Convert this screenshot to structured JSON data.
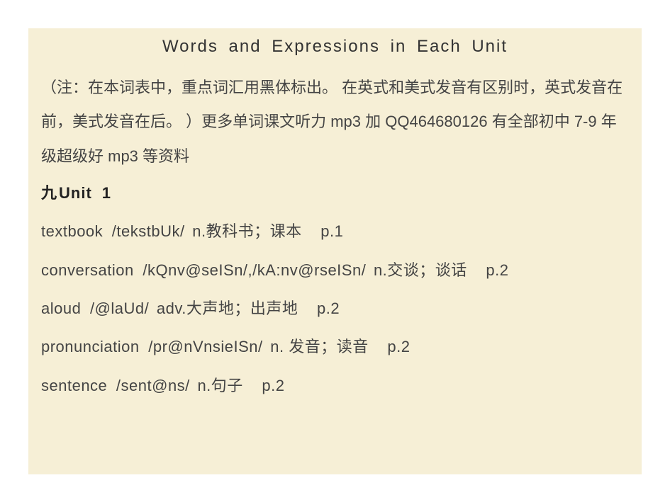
{
  "title": "Words  and  Expressions  in  Each  Unit",
  "note": "（注：在本词表中，重点词汇用黑体标出。  在英式和美式发音有区别时，英式发音在前，美式发音在后。 ）更多单词课文听力  mp3 加 QQ464680126 有全部初中 7-9 年级超级好 mp3 等资料",
  "unit": {
    "prefix": "九",
    "label": "Unit",
    "number": "1"
  },
  "entries": [
    {
      "word": "textbook",
      "phonetic": "/tekstbUk/",
      "definition": "n.教科书；课本",
      "page": "p.1"
    },
    {
      "word": "conversation",
      "phonetic": "/kQnv@seISn/,/kA:nv@rseISn/",
      "definition": "n.交谈；谈话",
      "page": "p.2"
    },
    {
      "word": "aloud",
      "phonetic": "/@laUd/",
      "definition": "adv.大声地；出声地",
      "page": "p.2"
    },
    {
      "word": "pronunciation",
      "phonetic": "/pr@nVnsieISn/",
      "definition": "n. 发音；读音",
      "page": "p.2"
    },
    {
      "word": "sentence",
      "phonetic": "/sent@ns/",
      "definition": "n.句子",
      "page": "p.2"
    }
  ]
}
